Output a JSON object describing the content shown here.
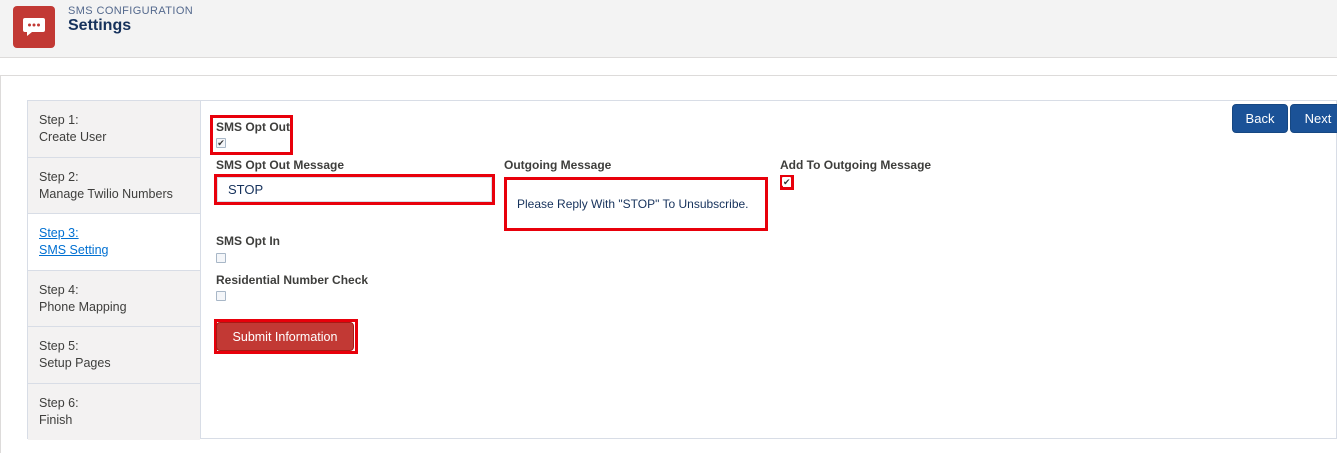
{
  "header": {
    "eyebrow": "SMS CONFIGURATION",
    "title": "Settings",
    "icon": "chat-bubble-icon",
    "accent_color": "#c23934"
  },
  "steps": [
    {
      "number": "Step 1:",
      "label": "Create User",
      "active": false
    },
    {
      "number": "Step 2:",
      "label": "Manage Twilio Numbers",
      "active": false
    },
    {
      "number": "Step 3:",
      "label": "SMS Setting",
      "active": true
    },
    {
      "number": "Step 4:",
      "label": "Phone Mapping",
      "active": false
    },
    {
      "number": "Step 5:",
      "label": "Setup Pages",
      "active": false
    },
    {
      "number": "Step 6:",
      "label": "Finish",
      "active": false
    }
  ],
  "nav": {
    "back_label": "Back",
    "next_label": "Next",
    "color": "#1b5297"
  },
  "form": {
    "sms_opt_out": {
      "label": "SMS Opt Out",
      "checked": true
    },
    "sms_opt_out_message": {
      "label": "SMS Opt Out Message",
      "value": "STOP"
    },
    "outgoing_message": {
      "label": "Outgoing Message",
      "value": "Please Reply With \"STOP\" To Unsubscribe."
    },
    "add_to_outgoing": {
      "label": "Add To Outgoing Message",
      "checked": true
    },
    "sms_opt_in": {
      "label": "SMS Opt In",
      "checked": false
    },
    "residential_check": {
      "label": "Residential Number Check",
      "checked": false
    },
    "submit_label": "Submit Information"
  },
  "highlight_color": "#e8000b"
}
